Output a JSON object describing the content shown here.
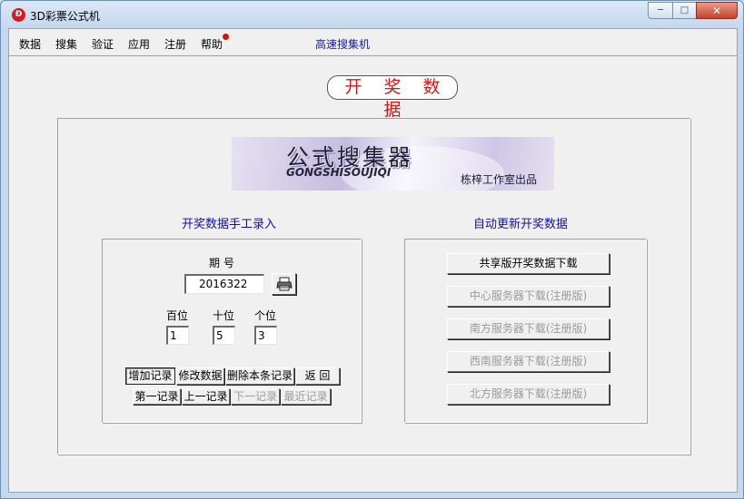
{
  "window": {
    "icon_glyph": "Ð",
    "title": "3D彩票公式机",
    "min_glyph": "─",
    "max_glyph": "□",
    "close_glyph": "✕"
  },
  "menu": {
    "items": [
      "数据",
      "搜集",
      "验证",
      "应用",
      "注册",
      "帮助"
    ],
    "link": "高速搜集机"
  },
  "main_title": "开 奖 数 据",
  "banner": {
    "main_text": "公式搜集器",
    "pinyin": "GONGSHISOUJIQI",
    "credit": "栋梓工作室出品"
  },
  "manual_entry": {
    "title": "开奖数据手工录入",
    "period_label": "期  号",
    "period_value": "2016322",
    "print_icon": "printer-icon",
    "digits": [
      {
        "label": "百位",
        "value": "1"
      },
      {
        "label": "十位",
        "value": "5"
      },
      {
        "label": "个位",
        "value": "3"
      }
    ],
    "action_buttons": [
      "增加记录",
      "修改数据",
      "删除本条记录",
      "返 回"
    ],
    "nav_buttons": [
      "第一记录",
      "上一记录",
      "下一记录",
      "最近记录"
    ]
  },
  "auto_update": {
    "title": "自动更新开奖数据",
    "buttons": [
      "共享版开奖数据下载",
      "中心服务器下载(注册版)",
      "南方服务器下载(注册版)",
      "西南服务器下载(注册版)",
      "北方服务器下载(注册版)"
    ]
  }
}
